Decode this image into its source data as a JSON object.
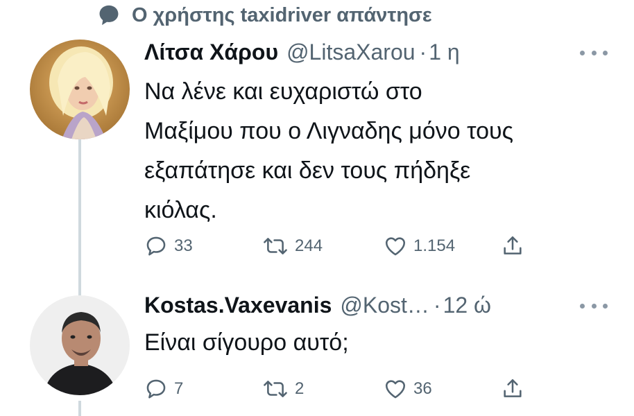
{
  "reply_context": {
    "text": "Ο χρήστης taxidriver απάντησε",
    "icon": "speech-bubble-icon"
  },
  "tweets": [
    {
      "name": "Λίτσα Χάρου",
      "handle": "@LitsaXarou",
      "separator": "·",
      "time": "1 η",
      "text": "Να λένε και ευχαριστώ στο\nΜαξίμου που ο Λιγναδης μόνο τους\nεξαπάτησε και δεν τους πήδηξε\nκιόλας.",
      "replies": "33",
      "retweets": "244",
      "likes": "1.154"
    },
    {
      "name": "Kostas.Vaxevanis",
      "handle": "@Kost…",
      "separator": "·",
      "time": "12 ώ",
      "text": "Είναι σίγουρο αυτό;",
      "replies": "7",
      "retweets": "2",
      "likes": "36"
    }
  ],
  "colors": {
    "secondary": "#536471",
    "text": "#0f1419",
    "thread_line": "#cfd9de"
  }
}
